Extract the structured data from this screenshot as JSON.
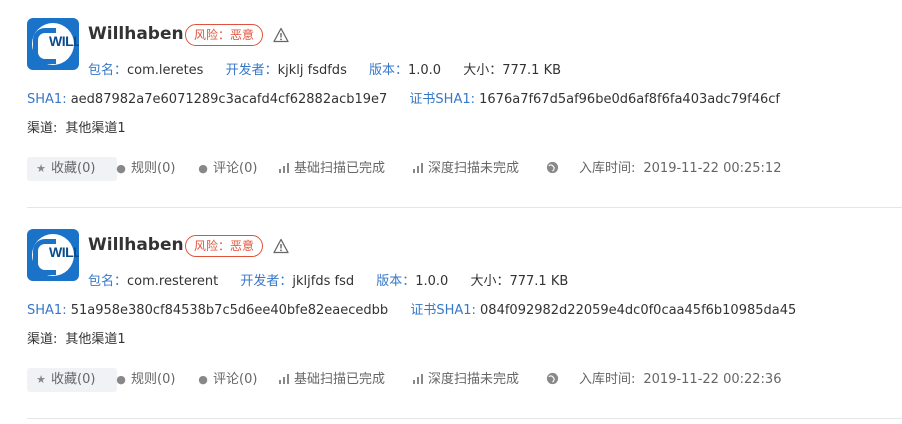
{
  "apps": [
    {
      "logo_text": "WILL",
      "name": "Willhaben",
      "risk_label": "风险：",
      "risk_value": "恶意",
      "package_label": "包名：",
      "package": "com.leretes",
      "developer_label": "开发者：",
      "developer": "kjklj fsdfds",
      "version_label": "版本：",
      "version": "1.0.0",
      "size_label": "大小：",
      "size": "777.1 KB",
      "sha1_label": "SHA1:",
      "sha1": "aed87982a7e6071289c3acafd4cf62882acb19e7",
      "cert_label": "证书SHA1:",
      "cert_sha1": "1676a7f67d5af96be0d6af8f6fa403adc79f46cf",
      "channel_label": "渠道:",
      "channel": "其他渠道1",
      "favorites": "收藏(0)",
      "rules": "规则(0)",
      "comments": "评论(0)",
      "basic_scan": "基础扫描已完成",
      "deep_scan": "深度扫描未完成",
      "ingest_time_label": "入库时间:",
      "ingest_time": "2019-11-22 00:25:12"
    },
    {
      "logo_text": "WILL",
      "name": "Willhaben",
      "risk_label": "风险：",
      "risk_value": "恶意",
      "package_label": "包名：",
      "package": "com.resterent",
      "developer_label": "开发者：",
      "developer": "jkljfds fsd",
      "version_label": "版本：",
      "version": "1.0.0",
      "size_label": "大小：",
      "size": "777.1 KB",
      "sha1_label": "SHA1:",
      "sha1": "51a958e380cf84538b7c5d6ee40bfe82eaecedbb",
      "cert_label": "证书SHA1:",
      "cert_sha1": "084f092982d22059e4dc0f0caa45f6b10985da45",
      "channel_label": "渠道:",
      "channel": "其他渠道1",
      "favorites": "收藏(0)",
      "rules": "规则(0)",
      "comments": "评论(0)",
      "basic_scan": "基础扫描已完成",
      "deep_scan": "深度扫描未完成",
      "ingest_time_label": "入库时间:",
      "ingest_time": "2019-11-22 00:22:36"
    }
  ],
  "colors": {
    "link": "#3778c8",
    "risk": "#e0533a",
    "brand": "#1a73c8"
  },
  "icons": [
    "star-icon",
    "rule-icon",
    "comment-icon",
    "bar-chart-icon",
    "globe-icon",
    "warning-icon"
  ]
}
